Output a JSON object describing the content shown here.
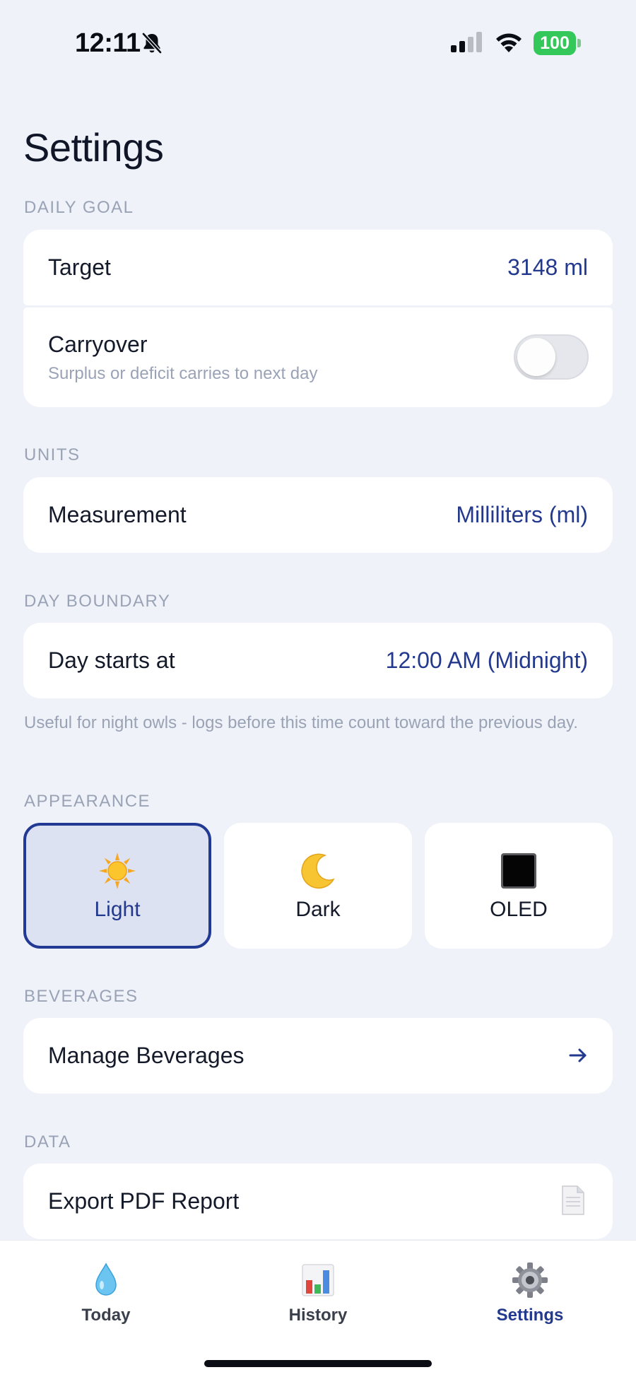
{
  "status_bar": {
    "time": "12:11",
    "battery": "100"
  },
  "page": {
    "title": "Settings"
  },
  "sections": {
    "daily_goal": {
      "header": "DAILY GOAL",
      "target_label": "Target",
      "target_value": "3148 ml",
      "carryover_label": "Carryover",
      "carryover_sub": "Surplus or deficit carries to next day",
      "carryover_enabled": false
    },
    "units": {
      "header": "UNITS",
      "label": "Measurement",
      "value": "Milliliters (ml)"
    },
    "day_boundary": {
      "header": "DAY BOUNDARY",
      "label": "Day starts at",
      "value": "12:00 AM (Midnight)",
      "footnote": "Useful for night owls - logs before this time count toward the previous day."
    },
    "appearance": {
      "header": "APPEARANCE",
      "options": [
        {
          "label": "Light",
          "icon": "sun-icon",
          "selected": true
        },
        {
          "label": "Dark",
          "icon": "moon-icon",
          "selected": false
        },
        {
          "label": "OLED",
          "icon": "black-square-icon",
          "selected": false
        }
      ]
    },
    "beverages": {
      "header": "BEVERAGES",
      "label": "Manage Beverages",
      "icon": "arrow-right-icon"
    },
    "data": {
      "header": "DATA",
      "label": "Export PDF Report",
      "icon": "document-icon"
    }
  },
  "tab_bar": {
    "tabs": [
      {
        "label": "Today",
        "icon": "water-drop-icon",
        "active": false
      },
      {
        "label": "History",
        "icon": "bar-chart-icon",
        "active": false
      },
      {
        "label": "Settings",
        "icon": "gear-icon",
        "active": true
      }
    ]
  },
  "colors": {
    "accent": "#23398e",
    "background": "#eff2f8",
    "card": "#ffffff",
    "secondary_text": "#9aa3b6",
    "battery": "#34c759"
  }
}
